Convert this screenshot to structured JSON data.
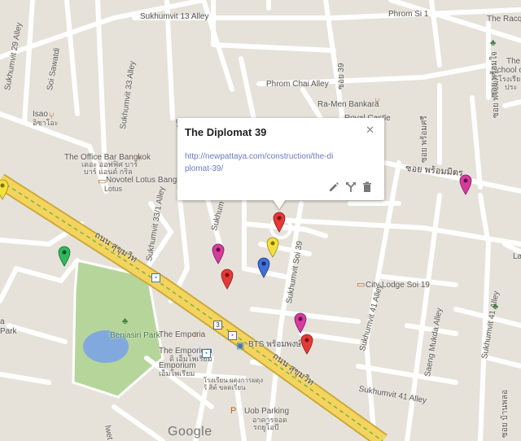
{
  "popup": {
    "title": "The Diplomat 39",
    "link": "http://newpattaya.com/construction/the-diplomat-39/"
  },
  "labels": {
    "sukhumvit13": "Sukhumvit 13 Alley",
    "phromsi1": "Phrom Si 1",
    "theracquet": "The Racque",
    "sukhumvit29": "Sukhumvit 29 Alley",
    "soisawatdi": "Soi Sawatdi",
    "sukhumvit33": "Sukhumvit 33 Alley",
    "sukhumvit33a": "Sukhumvit 33 Alley",
    "phromchai": "Phrom Chai Alley",
    "soi39thai": "ซอย 39",
    "ramen": "Ra-Men Bankara",
    "royalcastle": "Royal Castle",
    "school1": "The A",
    "school2": "School of",
    "school3": "โรงเรีย",
    "school4": "ประ",
    "isao": "Isao",
    "isaothai": "อิซาโอะ",
    "officebar": "The Office Bar Bangkok",
    "officebarthai": "เดอะ ออฟฟิศ บาร์",
    "officebarthai2": "บาร์ แอนด์ กริล",
    "novotel": "Novotel Lotus Bangkok",
    "novotelthai": "Lotus",
    "soipromit": "ซอย พร้อมมิตร",
    "sukhumvit331": "Sukhumvit 33/1 Alley",
    "sukhumvit_short": "Sukhum",
    "promsithai": "ซอย พร้อมศรี",
    "promsithai2": "ซอย พร้อมศรี",
    "sukhumvitrd1": "ถนน สุขุมวิท",
    "sukhumvitrd2": "ถนน สุขุมวิท",
    "citylodge": "City Lodge Soi 19",
    "sukhumvitsoi39": "Sukhumvit Soi 39",
    "sukhumvit41a": "Sukhumvit 41 Alley",
    "sukhumvit41b": "Sukhumvit 41 Alley",
    "sukhumvit41c": "Sukhumvit 41 Alley",
    "saengmukda": "Saeng Mukda Alley",
    "benjasiri": "Benjasiri Park",
    "emporia": "The Emporia",
    "emporium": "The Emporium",
    "emporiumthai": "ดิ เอ็มโพเรียม",
    "emporium2": "Emporium",
    "emporium2thai": "เอ็มโพเรียม",
    "bts": "BTS พร้อมพงษ์",
    "hospital1": "โรงเรียน ผดุงการผดุง",
    "hospital2": "ร้ สิต์ ขลดเรียน",
    "uob": "Uob Parking",
    "uobthai1": "อาคารจอด",
    "uobthai2": "รถยูโอบี",
    "la": "La",
    "baanthai": "ซอย บ้านพลอ",
    "soiphromjai": "ซอย พร้อมใจ",
    "lweet": "lwet",
    "park_letter": "Park",
    "h_letter": "a",
    "highway": "3"
  },
  "google_logo": "Google",
  "pins": [
    {
      "id": "pin-red-1",
      "color": "#e53935"
    },
    {
      "id": "pin-yellow-1",
      "color": "#f4e03a"
    },
    {
      "id": "pin-magenta-1",
      "color": "#d63b9e"
    },
    {
      "id": "pin-blue-1",
      "color": "#3f6fd8"
    },
    {
      "id": "pin-red-2",
      "color": "#e53935"
    },
    {
      "id": "pin-magenta-2",
      "color": "#d63b9e"
    },
    {
      "id": "pin-red-3",
      "color": "#e53935"
    },
    {
      "id": "pin-green-1",
      "color": "#2eb85c"
    },
    {
      "id": "pin-magenta-3",
      "color": "#d63b9e"
    },
    {
      "id": "pin-yellow-2",
      "color": "#f4e03a"
    }
  ],
  "colors": {
    "background": "#e6e2da",
    "road": "#ffffff",
    "highway": "#f4d35e",
    "park": "#b6d59b",
    "water": "#82a9dd",
    "link": "#6b79c9"
  }
}
